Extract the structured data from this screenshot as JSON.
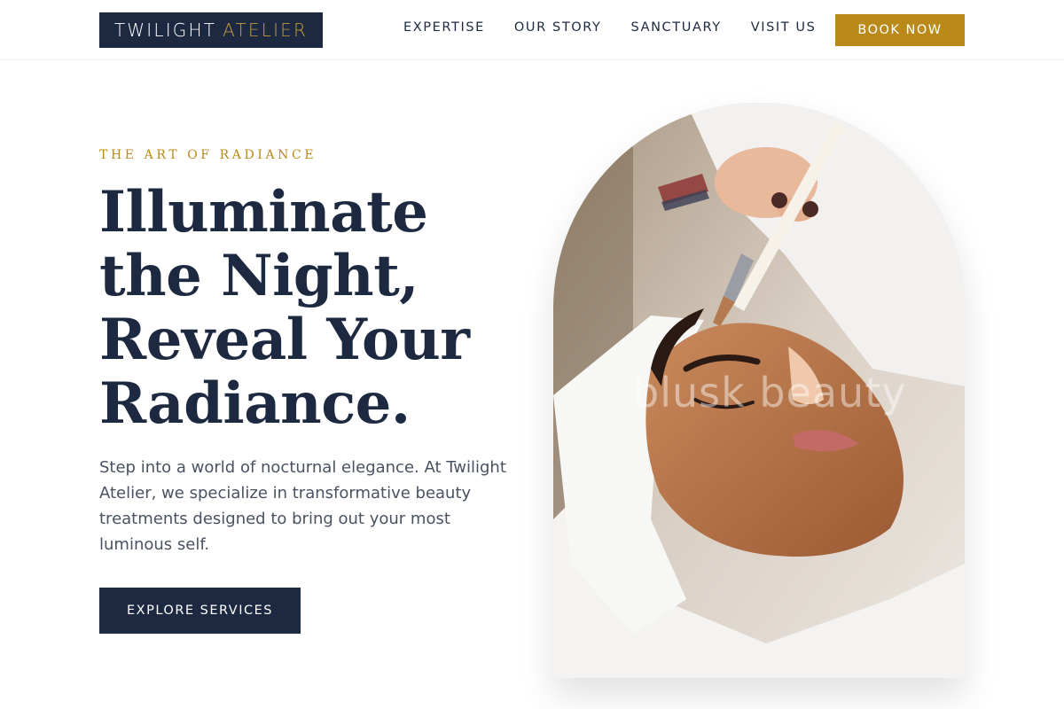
{
  "brand": {
    "word1": "TWILIGHT",
    "word2": "ATELIER"
  },
  "nav": {
    "items": [
      {
        "label": "EXPERTISE"
      },
      {
        "label": "OUR STORY"
      },
      {
        "label": "SANCTUARY"
      },
      {
        "label": "VISIT US"
      }
    ],
    "cta_label": "BOOK NOW"
  },
  "hero": {
    "eyebrow": "THE ART OF RADIANCE",
    "headline_lines": [
      "Illuminate",
      "the Night,",
      "Reveal Your",
      "Radiance."
    ],
    "description": "Step into a world of nocturnal elegance. At Twilight Atelier, we specialize in transformative beauty treatments designed to bring out your most luminous self.",
    "cta_label": "EXPLORE SERVICES",
    "image_watermark": "blusk beauty"
  },
  "colors": {
    "navy": "#1c2940",
    "gold": "#b98a19",
    "gold_text": "#c39a3a"
  }
}
